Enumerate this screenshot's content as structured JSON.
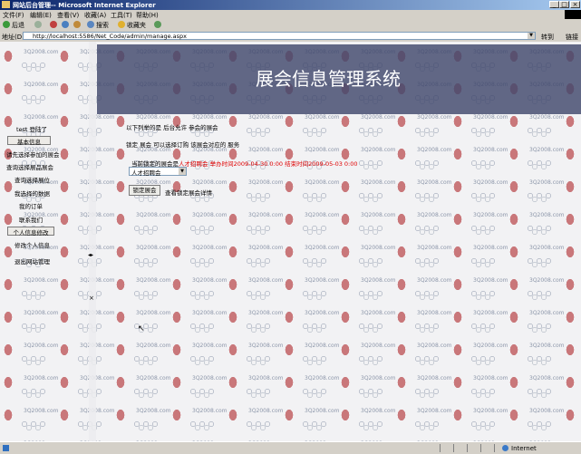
{
  "window": {
    "title": "网站后台管理-- Microsoft Internet Explorer"
  },
  "menu": {
    "items": [
      "文件(F)",
      "编辑(E)",
      "查看(V)",
      "收藏(A)",
      "工具(T)",
      "帮助(H)"
    ]
  },
  "toolbar": {
    "back": "后退",
    "search": "搜索",
    "favorites": "收藏夹"
  },
  "address": {
    "label": "地址(D)",
    "url": "http://localhost:5586/Net_Code/admin/manage.aspx",
    "go": "转到",
    "links": "链接"
  },
  "watermark": "3Q2008.com",
  "banner": {
    "title": "展会信息管理系统"
  },
  "sidebar": {
    "greeting": "test 登陆了",
    "items": [
      {
        "label": "基本信息"
      },
      {
        "label": "请先选择参加的展会"
      },
      {
        "label": "查询选择展品展会"
      },
      {
        "label": "查询选择展位"
      },
      {
        "label": "我选择的数据"
      },
      {
        "label": "我的订单"
      },
      {
        "label": "联系我们"
      },
      {
        "label": "个人信息修改"
      },
      {
        "label": "修改个人信息"
      },
      {
        "label": "退出网站管理"
      }
    ]
  },
  "main": {
    "intro": "以下列举的是   后台允许  参会的展会",
    "instruction": "锁定 展会 可以选择订购 该展会对应的 服务",
    "current_label": "当前锁定的展会是",
    "current_value": "人才招聘会  举办时间2009-04-30 0:00 结束时间2009-05-03 0:00",
    "select_value": "人才招聘会",
    "lock_button": "锁定展会",
    "detail_link": "查看锁定展会详情"
  },
  "status": {
    "zone": "Internet"
  }
}
